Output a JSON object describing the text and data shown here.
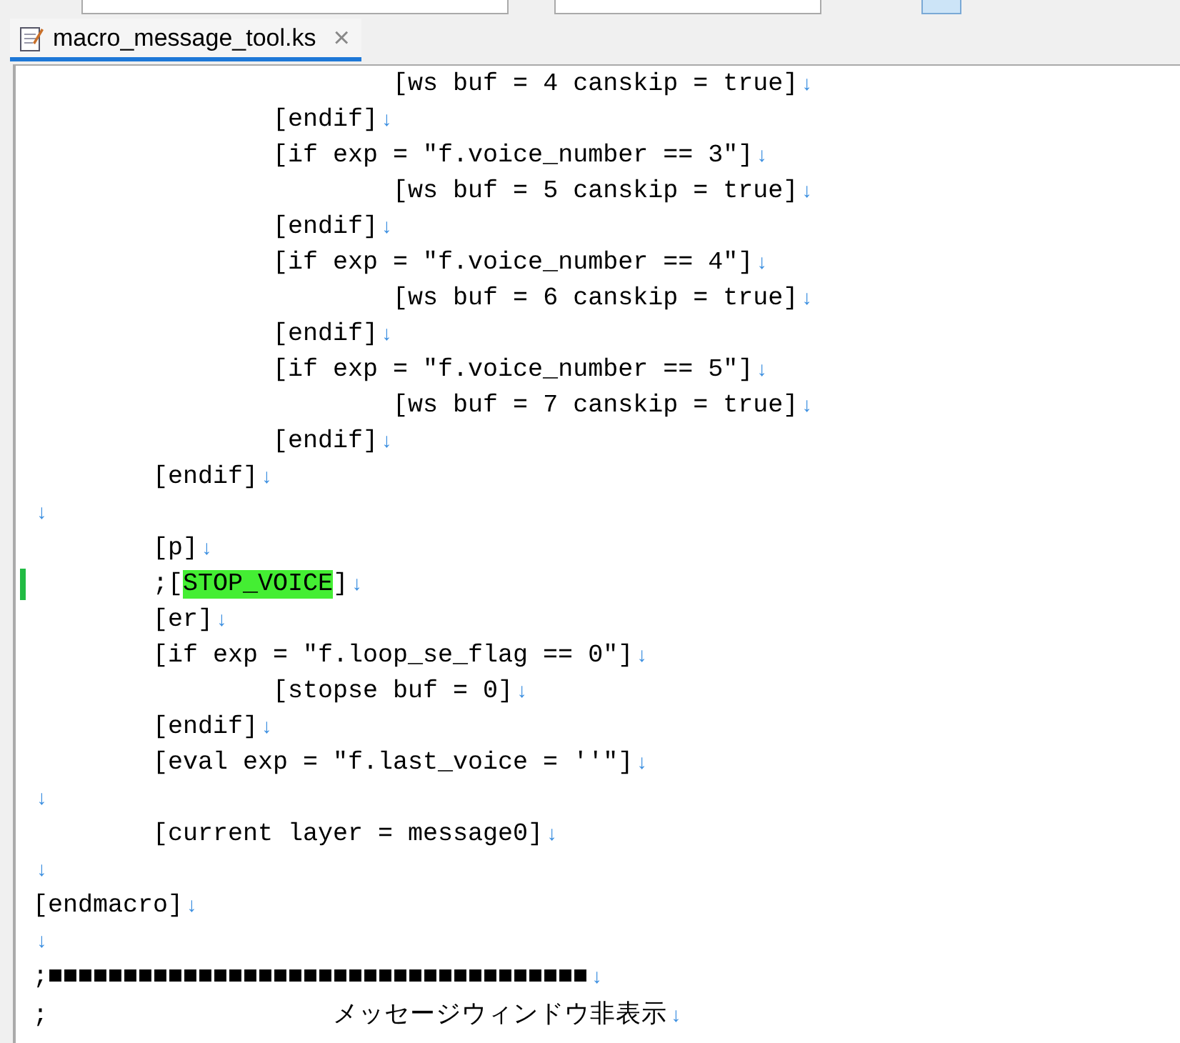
{
  "tab": {
    "label": "macro_message_tool.ks",
    "close": "×",
    "selected": true
  },
  "lines": [
    {
      "text": "\t\t\t[ws buf = 4 canskip = true]",
      "eol": "↓"
    },
    {
      "text": "\t\t[endif]",
      "eol": "↓"
    },
    {
      "text": "\t\t[if exp = ″f.voice_number == 3″]",
      "eol": "↓"
    },
    {
      "text": "\t\t\t[ws buf = 5 canskip = true]",
      "eol": "↓"
    },
    {
      "text": "\t\t[endif]",
      "eol": "↓"
    },
    {
      "text": "\t\t[if exp = ″f.voice_number == 4″]",
      "eol": "↓"
    },
    {
      "text": "\t\t\t[ws buf = 6 canskip = true]",
      "eol": "↓"
    },
    {
      "text": "\t\t[endif]",
      "eol": "↓"
    },
    {
      "text": "\t\t[if exp = ″f.voice_number == 5″]",
      "eol": "↓"
    },
    {
      "text": "\t\t\t[ws buf = 7 canskip = true]",
      "eol": "↓"
    },
    {
      "text": "\t\t[endif]",
      "eol": "↓"
    },
    {
      "text": "\t[endif]",
      "eol": "↓"
    },
    {
      "eol": "↓"
    },
    {
      "text": "\t[p]",
      "eol": "↓"
    },
    {
      "text": "\t;[",
      "highlight": "STOP_VOICE",
      "after": "]",
      "eol": "↓",
      "modified": true
    },
    {
      "text": "\t[er]",
      "eol": "↓"
    },
    {
      "text": "\t[if exp = ″f.loop_se_flag == 0″]",
      "eol": "↓"
    },
    {
      "text": "\t\t[stopse buf = 0]",
      "eol": "↓"
    },
    {
      "text": "\t[endif]",
      "eol": "↓"
    },
    {
      "text": "\t[eval exp = ″f.last_voice = ''″]",
      "eol": "↓"
    },
    {
      "eol": "↓"
    },
    {
      "text": "\t[current layer = message0]",
      "eol": "↓"
    },
    {
      "eol": "↓"
    },
    {
      "text": "[endmacro]",
      "eol": "↓"
    },
    {
      "eol": "↓"
    },
    {
      "text": ";■■■■■■■■■■■■■■■■■■■■■■■■■■■■■■■■■■■■",
      "eol": "↓"
    },
    {
      "text": ";                   メッセージウィンドウ非表示",
      "eol": "↓"
    }
  ]
}
